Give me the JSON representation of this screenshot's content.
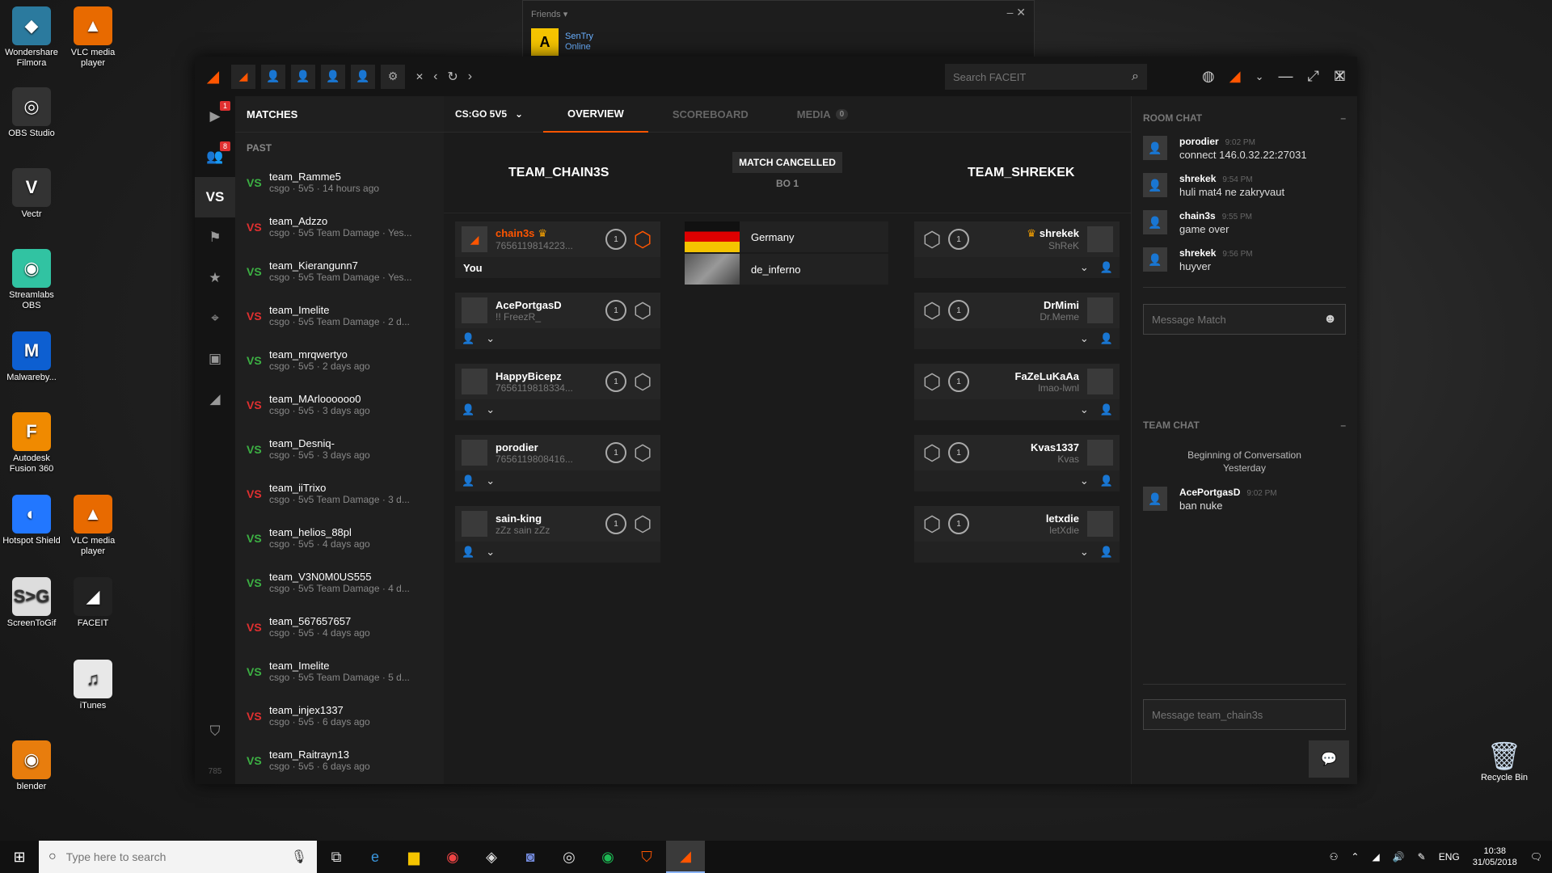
{
  "desktop": {
    "icons": [
      {
        "label": "Wondershare Filmora",
        "glyph": "◆",
        "color": "#2b7a9e"
      },
      {
        "label": "VLC media player",
        "glyph": "▲",
        "color": "#e86a00"
      },
      {
        "label": "OBS Studio",
        "glyph": "◎",
        "color": "#333"
      },
      {
        "label": "Vectr",
        "glyph": "V",
        "color": "#333"
      },
      {
        "label": "Streamlabs OBS",
        "glyph": "◉",
        "color": "#31c3a2"
      },
      {
        "label": "Malwareby...",
        "glyph": "M",
        "color": "#0d5fd1"
      },
      {
        "label": "Autodesk Fusion 360",
        "glyph": "F",
        "color": "#f08a00"
      },
      {
        "label": "Hotspot Shield",
        "glyph": "◐",
        "color": "#2277ff"
      },
      {
        "label": "VLC media player",
        "glyph": "▲",
        "color": "#e86a00"
      },
      {
        "label": "ScreenToGif",
        "glyph": "S>G",
        "color": "#ddd"
      },
      {
        "label": "FACEIT",
        "glyph": "◢",
        "color": "#222"
      },
      {
        "label": "iTunes",
        "glyph": "♫",
        "color": "#e8e8e8"
      },
      {
        "label": "blender",
        "glyph": "◉",
        "color": "#e87d0d"
      }
    ],
    "recycle_bin": "Recycle Bin"
  },
  "friends": {
    "title": "Friends",
    "user": "SenTry",
    "status": "Online"
  },
  "app": {
    "search_placeholder": "Search FACEIT",
    "matches_title": "MATCHES",
    "past_label": "PAST",
    "game_selector": "CS:GO 5V5",
    "tabs": {
      "overview": "OVERVIEW",
      "scoreboard": "SCOREBOARD",
      "media": "MEDIA",
      "media_count": "0"
    },
    "iconbar_badges": {
      "play": "1",
      "friends": "8"
    },
    "vs_label": "VS",
    "footer_count": "785"
  },
  "matches": [
    {
      "vs": "VS",
      "result": "win",
      "team": "team_Ramme5",
      "meta": "csgo · 5v5 · 14 hours ago"
    },
    {
      "vs": "VS",
      "result": "loss",
      "team": "team_Adzzo",
      "meta": "csgo · 5v5 Team Damage · Yes..."
    },
    {
      "vs": "VS",
      "result": "win",
      "team": "team_Kierangunn7",
      "meta": "csgo · 5v5 Team Damage · Yes..."
    },
    {
      "vs": "VS",
      "result": "loss",
      "team": "team_Imelite",
      "meta": "csgo · 5v5 Team Damage · 2 d..."
    },
    {
      "vs": "VS",
      "result": "win",
      "team": "team_mrqwertyo",
      "meta": "csgo · 5v5 · 2 days ago"
    },
    {
      "vs": "VS",
      "result": "loss",
      "team": "team_MArloooooo0",
      "meta": "csgo · 5v5 · 3 days ago"
    },
    {
      "vs": "VS",
      "result": "win",
      "team": "team_Desniq-",
      "meta": "csgo · 5v5 · 3 days ago"
    },
    {
      "vs": "VS",
      "result": "loss",
      "team": "team_iiTrixo",
      "meta": "csgo · 5v5 Team Damage · 3 d..."
    },
    {
      "vs": "VS",
      "result": "win",
      "team": "team_helios_88pl",
      "meta": "csgo · 5v5 · 4 days ago"
    },
    {
      "vs": "VS",
      "result": "win",
      "team": "team_V3N0M0US555",
      "meta": "csgo · 5v5 Team Damage · 4 d..."
    },
    {
      "vs": "VS",
      "result": "loss",
      "team": "team_567657657",
      "meta": "csgo · 5v5 · 4 days ago"
    },
    {
      "vs": "VS",
      "result": "win",
      "team": "team_Imelite",
      "meta": "csgo · 5v5 Team Damage · 5 d..."
    },
    {
      "vs": "VS",
      "result": "loss",
      "team": "team_injex1337",
      "meta": "csgo · 5v5 · 6 days ago"
    },
    {
      "vs": "VS",
      "result": "win",
      "team": "team_Raitrayn13",
      "meta": "csgo · 5v5 · 6 days ago"
    }
  ],
  "match": {
    "team_left": "TEAM_CHAIN3S",
    "team_right": "TEAM_SHREKEK",
    "status": "MATCH CANCELLED",
    "format": "BO 1",
    "location": "Germany",
    "map": "de_inferno",
    "you_label": "You",
    "left_players": [
      {
        "name": "chain3s",
        "sub": "7656119814223...",
        "level": "1",
        "crown": "♛",
        "me": true
      },
      {
        "name": "AcePortgasD",
        "sub": "!! FreezR_",
        "level": "1"
      },
      {
        "name": "HappyBicepz",
        "sub": "7656119818334...",
        "level": "1"
      },
      {
        "name": "porodier",
        "sub": "7656119808416...",
        "level": "1"
      },
      {
        "name": "sain-king",
        "sub": "zZz sain zZz",
        "level": "1"
      }
    ],
    "right_players": [
      {
        "name": "shrekek",
        "sub": "ShReK",
        "level": "1",
        "crown": "♛"
      },
      {
        "name": "DrMimi",
        "sub": "Dr.Meme",
        "level": "1"
      },
      {
        "name": "FaZeLuKaAa",
        "sub": "lmao-lwnl",
        "level": "1"
      },
      {
        "name": "Kvas1337",
        "sub": "Kvas",
        "level": "1"
      },
      {
        "name": "letxdie",
        "sub": "letXdie",
        "level": "1"
      }
    ]
  },
  "chat": {
    "room_title": "ROOM CHAT",
    "room_messages": [
      {
        "user": "porodier",
        "time": "9:02 PM",
        "text": "connect 146.0.32.22:27031"
      },
      {
        "user": "shrekek",
        "time": "9:54 PM",
        "text": "huli mat4 ne zakryvaut"
      },
      {
        "user": "chain3s",
        "time": "9:55 PM",
        "text": "game over"
      },
      {
        "user": "shrekek",
        "time": "9:56 PM",
        "text": "huyver"
      }
    ],
    "room_placeholder": "Message Match",
    "team_title": "TEAM CHAT",
    "team_sep_1": "Beginning of Conversation",
    "team_sep_2": "Yesterday",
    "team_messages": [
      {
        "user": "AcePortgasD",
        "time": "9:02 PM",
        "text": "ban nuke"
      }
    ],
    "team_placeholder": "Message team_chain3s"
  },
  "taskbar": {
    "search_placeholder": "Type here to search",
    "lang": "ENG",
    "time": "10:38",
    "date": "31/05/2018"
  }
}
